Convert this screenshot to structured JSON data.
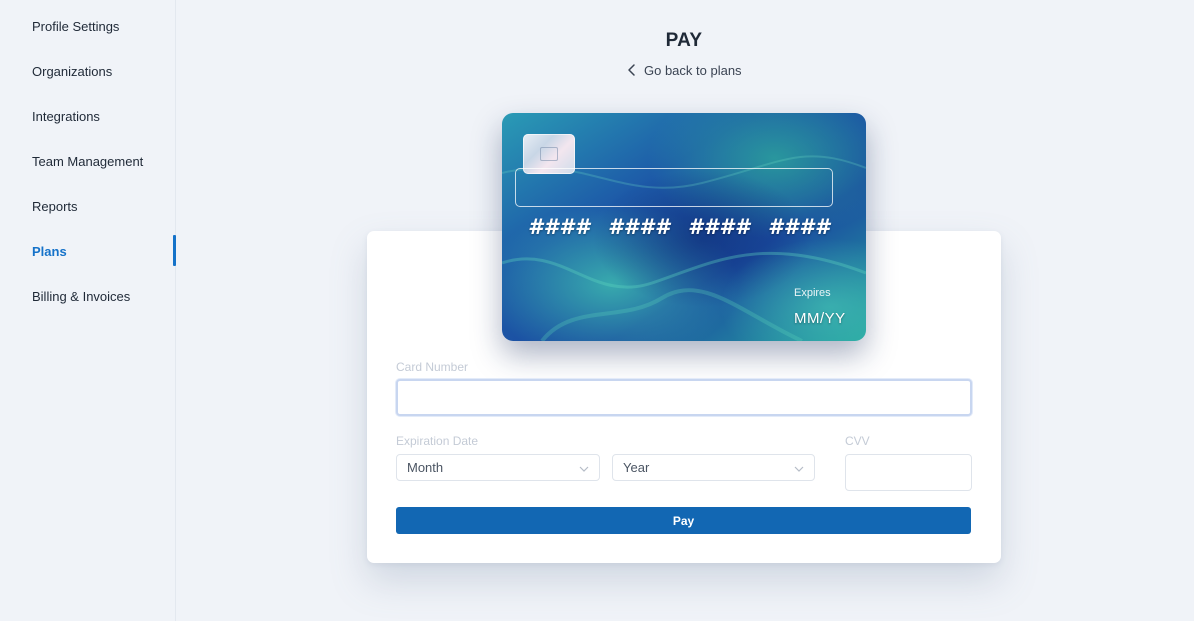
{
  "sidebar": {
    "items": [
      {
        "label": "Profile Settings"
      },
      {
        "label": "Organizations"
      },
      {
        "label": "Integrations"
      },
      {
        "label": "Team Management"
      },
      {
        "label": "Reports"
      },
      {
        "label": "Plans",
        "active": true
      },
      {
        "label": "Billing & Invoices"
      }
    ]
  },
  "header": {
    "title": "PAY",
    "back_link": "Go back to plans"
  },
  "card": {
    "number_groups": [
      "####",
      "####",
      "####",
      "####"
    ],
    "expires_label": "Expires",
    "expires_value": "MM/YY"
  },
  "form": {
    "card_number_label": "Card Number",
    "card_number_value": "",
    "expiration_label": "Expiration Date",
    "month_selected": "Month",
    "year_selected": "Year",
    "cvv_label": "CVV",
    "cvv_value": "",
    "pay_button": "Pay"
  },
  "colors": {
    "accent": "#1572c9",
    "pay_button": "#1267b3",
    "background": "#f0f3f8"
  },
  "icons": {
    "back": "chevron-left-icon",
    "select": "chevron-down-icon"
  }
}
